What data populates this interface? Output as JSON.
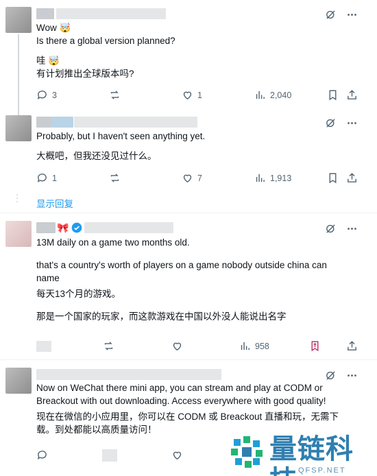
{
  "tweets": [
    {
      "lines": [
        "Wow 🤯",
        "Is there a global version planned?",
        "哇 🤯",
        "有计划推出全球版本吗?"
      ],
      "replies": "3",
      "likes": "1",
      "views": "2,040"
    },
    {
      "lines": [
        "Probably, but I haven't seen anything yet.",
        "大概吧，但我还没见过什么。"
      ],
      "replies": "1",
      "likes": "7",
      "views": "1,913",
      "show_replies": "显示回复"
    },
    {
      "ribbon": "🎀",
      "lines": [
        "13M daily on a game two months old.",
        "that's a country's worth of players on a game nobody outside china can name",
        "每天13个月的游戏。",
        "那是一个国家的玩家，而这款游戏在中国以外没人能说出名字"
      ],
      "views": "958"
    },
    {
      "lines": [
        "Now on WeChat there mini app, you can stream and play at CODM or Breackout with out downloading. Access everywhere with good quality!",
        "现在在微信的小应用里，你可以在 CODM 或 Breackout 直播和玩，无需下载。到处都能以高质量访问！"
      ]
    }
  ],
  "watermark": {
    "title": "量链科技",
    "subtitle": "QFSP.NET"
  },
  "icons": [
    "grok-icon",
    "more-icon",
    "reply-icon",
    "retweet-icon",
    "like-icon",
    "views-icon",
    "bookmark-icon",
    "share-icon",
    "verified-icon"
  ],
  "colors": {
    "link": "#1d9bf0",
    "muted": "#536471",
    "verified": "#1d9bf0",
    "watermark": "#2f7fb0"
  }
}
